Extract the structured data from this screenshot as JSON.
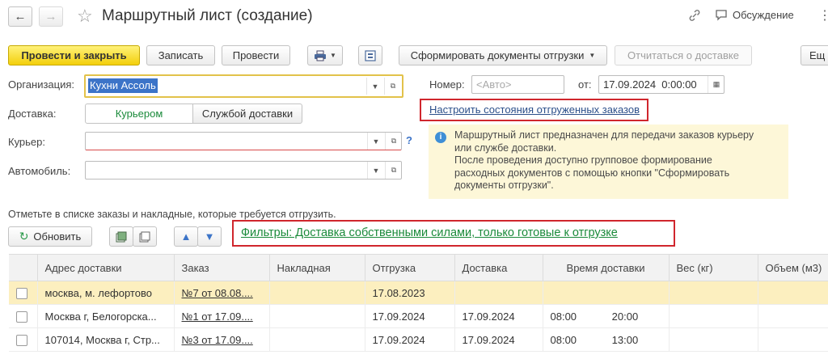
{
  "window": {
    "title": "Маршрутный лист (создание)",
    "discussion_label": "Обсуждение"
  },
  "toolbar": {
    "post_close_label": "Провести и закрыть",
    "save_label": "Записать",
    "post_label": "Провести",
    "form_docs_label": "Сформировать документы отгрузки",
    "report_label": "Отчитаться о доставке",
    "more_label": "Ещ"
  },
  "form": {
    "organization_label": "Организация:",
    "organization_value": "Кухни Ассоль",
    "number_label": "Номер:",
    "number_placeholder": "<Авто>",
    "date_label": "от:",
    "date_value": "17.09.2024  0:00:00",
    "delivery_label": "Доставка:",
    "delivery_courier": "Курьером",
    "delivery_service": "Службой доставки",
    "courier_label": "Курьер:",
    "courier_help": "?",
    "car_label": "Автомобиль:",
    "setup_link": "Настроить состояния отгруженных заказов"
  },
  "info": {
    "text1": "Маршрутный лист предназначен для передачи заказов курьеру",
    "text2": "или службе доставки.",
    "text3": "После проведения доступно групповое формирование",
    "text4": "расходных документов с помощью кнопки \"Сформировать",
    "text5": "документы отгрузки\"."
  },
  "list": {
    "hint": "Отметьте в списке заказы и накладные, которые требуется отгрузить.",
    "refresh_label": "Обновить",
    "filter_link": "Фильтры: Доставка собственными силами, только готовые к отгрузке"
  },
  "table": {
    "headers": [
      "Адрес доставки",
      "Заказ",
      "Накладная",
      "Отгрузка",
      "Доставка",
      "Время доставки",
      "Вес (кг)",
      "Объем (м3)"
    ],
    "rows": [
      {
        "address": "москва, м. лефортово",
        "order": "№7 от 08.08....",
        "invoice": "",
        "ship": "17.08.2023",
        "delivery": "",
        "time_from": "",
        "time_to": "",
        "weight": "",
        "volume": ""
      },
      {
        "address": "Москва г, Белогорска...",
        "order": "№1 от 17.09....",
        "invoice": "",
        "ship": "17.09.2024",
        "delivery": "17.09.2024",
        "time_from": "08:00",
        "time_to": "20:00",
        "weight": "",
        "volume": ""
      },
      {
        "address": "107014, Москва г, Стр...",
        "order": "№3 от 17.09....",
        "invoice": "",
        "ship": "17.09.2024",
        "delivery": "17.09.2024",
        "time_from": "08:00",
        "time_to": "13:00",
        "weight": "",
        "volume": ""
      }
    ]
  },
  "colors": {
    "accent_yellow": "#f3cf0b",
    "highlight_red": "#d0262d",
    "green_text": "#1a8a3a",
    "info_bg": "#fdf7d8",
    "selected_row": "#fcefbf"
  }
}
